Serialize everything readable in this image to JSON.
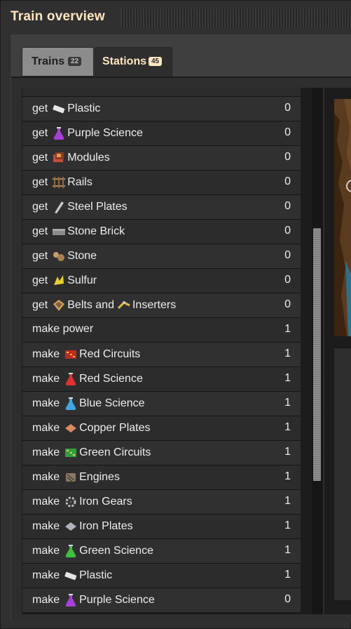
{
  "window": {
    "title": "Train overview"
  },
  "tabs": [
    {
      "label": "Trains",
      "count": "22"
    },
    {
      "label": "Stations",
      "count": "45"
    }
  ],
  "stations": [
    {
      "prefix": "get",
      "icon": "plastic-icon",
      "name": "Plastic",
      "count": "0"
    },
    {
      "prefix": "get",
      "icon": "purple-science-icon",
      "name": "Purple Science",
      "count": "0"
    },
    {
      "prefix": "get",
      "icon": "modules-icon",
      "name": "Modules",
      "count": "0"
    },
    {
      "prefix": "get",
      "icon": "rails-icon",
      "name": "Rails",
      "count": "0"
    },
    {
      "prefix": "get",
      "icon": "steel-plate-icon",
      "name": "Steel Plates",
      "count": "0"
    },
    {
      "prefix": "get",
      "icon": "stone-brick-icon",
      "name": "Stone Brick",
      "count": "0"
    },
    {
      "prefix": "get",
      "icon": "stone-icon",
      "name": "Stone",
      "count": "0"
    },
    {
      "prefix": "get",
      "icon": "sulfur-icon",
      "name": "Sulfur",
      "count": "0"
    },
    {
      "prefix": "get",
      "icon": "belt-icon",
      "name": "Belts and",
      "icon2": "inserter-icon",
      "name2": "Inserters",
      "count": "0"
    },
    {
      "prefix": "make",
      "icon": "",
      "name": "power",
      "count": "1"
    },
    {
      "prefix": "make",
      "icon": "red-circuit-icon",
      "name": "Red Circuits",
      "count": "1"
    },
    {
      "prefix": "make",
      "icon": "red-science-icon",
      "name": "Red Science",
      "count": "1"
    },
    {
      "prefix": "make",
      "icon": "blue-science-icon",
      "name": "Blue Science",
      "count": "1"
    },
    {
      "prefix": "make",
      "icon": "copper-plate-icon",
      "name": "Copper Plates",
      "count": "1"
    },
    {
      "prefix": "make",
      "icon": "green-circuit-icon",
      "name": "Green Circuits",
      "count": "1"
    },
    {
      "prefix": "make",
      "icon": "engine-icon",
      "name": "Engines",
      "count": "1"
    },
    {
      "prefix": "make",
      "icon": "iron-gear-icon",
      "name": "Iron Gears",
      "count": "1"
    },
    {
      "prefix": "make",
      "icon": "iron-plate-icon",
      "name": "Iron Plates",
      "count": "1"
    },
    {
      "prefix": "make",
      "icon": "green-science-icon",
      "name": "Green Science",
      "count": "1"
    },
    {
      "prefix": "make",
      "icon": "plastic-icon",
      "name": "Plastic",
      "count": "1"
    },
    {
      "prefix": "make",
      "icon": "purple-science-icon",
      "name": "Purple Science",
      "count": "0"
    }
  ],
  "colors": {
    "title": "#ffe6c0",
    "row_text": "#ededed",
    "selected_tab_text": "#ffe6c0"
  }
}
